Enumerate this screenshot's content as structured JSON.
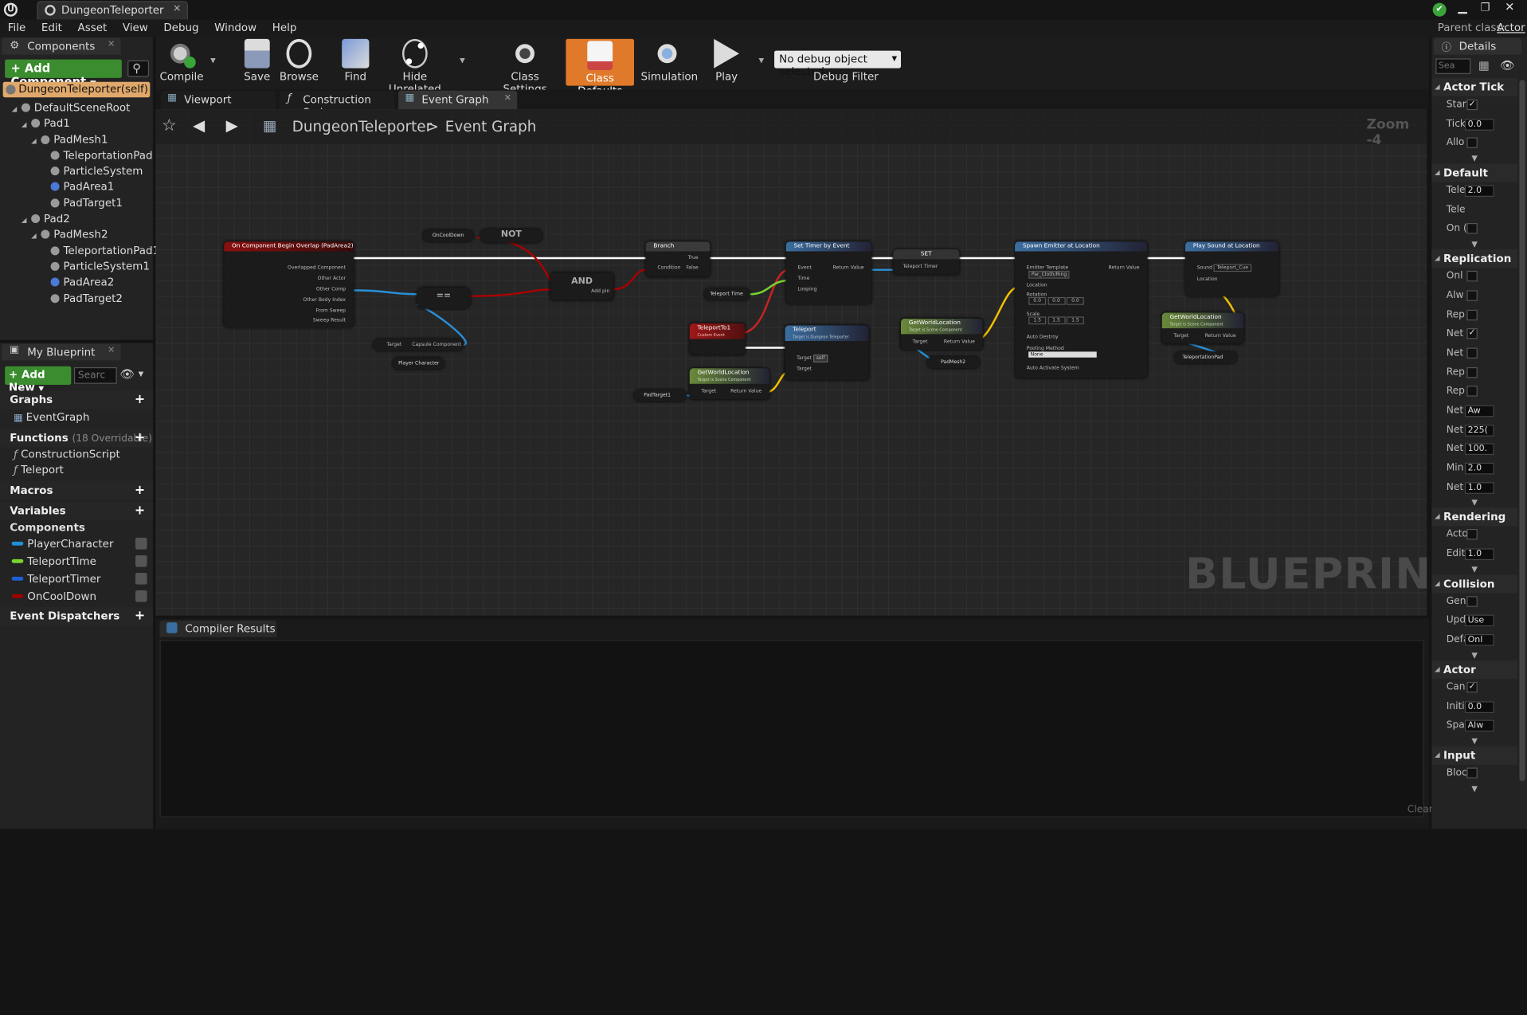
{
  "window": {
    "doc_tab": "DungeonTeleporter",
    "parent_class_label": "Parent class:",
    "parent_class_value": "Actor"
  },
  "menu": [
    "File",
    "Edit",
    "Asset",
    "View",
    "Debug",
    "Window",
    "Help"
  ],
  "components_panel": {
    "tab": "Components",
    "add_button": "+ Add Component",
    "self_item": "DungeonTeleporter(self)",
    "tree": [
      {
        "label": "DefaultSceneRoot",
        "indent": 0
      },
      {
        "label": "Pad1",
        "indent": 1
      },
      {
        "label": "PadMesh1",
        "indent": 2
      },
      {
        "label": "TeleportationPad",
        "indent": 3
      },
      {
        "label": "ParticleSystem",
        "indent": 3
      },
      {
        "label": "PadArea1",
        "indent": 3
      },
      {
        "label": "PadTarget1",
        "indent": 3
      },
      {
        "label": "Pad2",
        "indent": 1
      },
      {
        "label": "PadMesh2",
        "indent": 2
      },
      {
        "label": "TeleportationPad1",
        "indent": 3
      },
      {
        "label": "ParticleSystem1",
        "indent": 3
      },
      {
        "label": "PadArea2",
        "indent": 3
      },
      {
        "label": "PadTarget2",
        "indent": 3
      }
    ]
  },
  "my_blueprint": {
    "tab": "My Blueprint",
    "add_new": "+ Add New",
    "search_placeholder": "Searc",
    "graphs_label": "Graphs",
    "event_graph": "EventGraph",
    "functions_label": "Functions",
    "functions_count": "(18 Overridable)",
    "functions": [
      "ConstructionScript",
      "Teleport"
    ],
    "macros_label": "Macros",
    "variables_label": "Variables",
    "components_label": "Components",
    "variables": [
      {
        "name": "PlayerCharacter",
        "color": "#1f8fd6"
      },
      {
        "name": "TeleportTime",
        "color": "#7ad431"
      },
      {
        "name": "TeleportTimer",
        "color": "#1f5fd6"
      },
      {
        "name": "OnCoolDown",
        "color": "#a00000"
      }
    ],
    "dispatchers_label": "Event Dispatchers"
  },
  "toolbar": {
    "compile": "Compile",
    "save": "Save",
    "browse": "Browse",
    "find": "Find",
    "hide_unrelated": "Hide Unrelated",
    "class_settings": "Class Settings",
    "class_defaults": "Class Defaults",
    "simulation": "Simulation",
    "play": "Play",
    "debug_select": "No debug object selected",
    "debug_filter": "Debug Filter"
  },
  "editor_tabs": [
    "Viewport",
    "Construction Scrip",
    "Event Graph"
  ],
  "graph": {
    "breadcrumb_root": "DungeonTeleporter",
    "breadcrumb_sep": ">",
    "breadcrumb_current": "Event Graph",
    "zoom": "Zoom -4",
    "watermark": "BLUEPRINT",
    "nodes": {
      "overlap_title": "On Component Begin Overlap (PadArea2)",
      "overlap_pins": [
        "Overlapped Component",
        "Other Actor",
        "Other Comp",
        "Other Body Index",
        "From Sweep",
        "Sweep Result"
      ],
      "oncooldown": "OnCoolDown",
      "not": "NOT",
      "and": "AND",
      "and_pin": "Add pin",
      "equals": "==",
      "target_capsule_a": "Target",
      "target_capsule_b": "Capsule Component",
      "player_character": "Player Character",
      "branch_title": "Branch",
      "branch_true": "True",
      "branch_false": "False",
      "branch_condition": "Condition",
      "timer_title": "Set Timer by Event",
      "timer_pins": [
        "Event",
        "Time",
        "Looping"
      ],
      "timer_return": "Return Value",
      "teleport_time": "Teleport Time",
      "set_title": "SET",
      "set_pin": "Teleport Timer",
      "teleportto_title": "TeleportTo1",
      "teleportto_sub": "Custom Event",
      "teleport_title": "Teleport",
      "teleport_sub": "Target is Dungeon Teleporter",
      "teleport_target": "Target",
      "teleport_self": "self",
      "teleport_target2": "Target",
      "gwl1_title": "GetWorldLocation",
      "gwl1_sub": "Target is Scene Component",
      "gwl1_target": "Target",
      "gwl1_return": "Return Value",
      "padtarget1": "PadTarget1",
      "gwl2_title": "GetWorldLocation",
      "gwl2_sub": "Target is Scene Component",
      "gwl2_target": "Target",
      "gwl2_return": "Return Value",
      "padmesh2": "PadMesh2",
      "spawn_title": "Spawn Emitter at Location",
      "spawn_pins": [
        "Emitter Template",
        "Location",
        "Rotation",
        "Scale",
        "Auto Destroy",
        "Pooling Method",
        "Auto Activate System"
      ],
      "spawn_template": "Par_Cloth/Ring",
      "spawn_rot": [
        "0.0",
        "0.0",
        "0.0"
      ],
      "spawn_scale": [
        "1.5",
        "1.5",
        "1.5"
      ],
      "spawn_pool": "None",
      "spawn_return": "Return Value",
      "sound_title": "Play Sound at Location",
      "sound_pins": [
        "Sound",
        "Location"
      ],
      "sound_value": "Teleport_Cue",
      "gwl3_title": "GetWorldLocation",
      "gwl3_sub": "Target is Scene Component",
      "gwl3_target": "Target",
      "gwl3_return": "Return Value",
      "teleportationpad": "TeleportationPad"
    }
  },
  "compiler": {
    "tab": "Compiler Results",
    "clear": "Clear"
  },
  "details": {
    "tab": "Details",
    "search_placeholder": "Sea",
    "sections": [
      {
        "title": "Actor Tick",
        "rows": [
          {
            "label": "Star",
            "type": "check",
            "checked": true
          },
          {
            "label": "Tick",
            "type": "num",
            "value": "0.0"
          },
          {
            "label": "Allo",
            "type": "check",
            "checked": false
          }
        ]
      },
      {
        "title": "Default",
        "rows": [
          {
            "label": "Tele",
            "type": "num",
            "value": "2.0"
          },
          {
            "label": "Tele",
            "type": "none",
            "value": ""
          },
          {
            "label": "On (",
            "type": "check",
            "checked": false
          }
        ]
      },
      {
        "title": "Replication",
        "rows": [
          {
            "label": "Onl",
            "type": "check",
            "checked": false
          },
          {
            "label": "Alw",
            "type": "check",
            "checked": false
          },
          {
            "label": "Rep",
            "type": "check",
            "checked": false
          },
          {
            "label": "Net",
            "type": "check",
            "checked": true
          },
          {
            "label": "Net",
            "type": "check",
            "checked": false
          },
          {
            "label": "Rep",
            "type": "check",
            "checked": false
          },
          {
            "label": "Rep",
            "type": "check",
            "checked": false
          },
          {
            "label": "Net",
            "type": "drop",
            "value": "Aw"
          },
          {
            "label": "Net",
            "type": "num",
            "value": "225("
          },
          {
            "label": "Net",
            "type": "num",
            "value": "100."
          },
          {
            "label": "Min",
            "type": "num",
            "value": "2.0"
          },
          {
            "label": "Net",
            "type": "num",
            "value": "1.0"
          }
        ]
      },
      {
        "title": "Rendering",
        "rows": [
          {
            "label": "Acto",
            "type": "check",
            "checked": false
          },
          {
            "label": "Edit",
            "type": "num",
            "value": "1.0"
          }
        ]
      },
      {
        "title": "Collision",
        "rows": [
          {
            "label": "Gen",
            "type": "check",
            "checked": false
          },
          {
            "label": "Upd",
            "type": "drop",
            "value": "Use"
          },
          {
            "label": "Defa",
            "type": "drop",
            "value": "Onl"
          }
        ]
      },
      {
        "title": "Actor",
        "rows": [
          {
            "label": "Can",
            "type": "check",
            "checked": true
          },
          {
            "label": "Initi",
            "type": "num",
            "value": "0.0"
          },
          {
            "label": "Spa",
            "type": "drop",
            "value": "Alw"
          }
        ]
      },
      {
        "title": "Input",
        "rows": [
          {
            "label": "Bloc",
            "type": "check",
            "checked": false
          }
        ]
      }
    ]
  }
}
